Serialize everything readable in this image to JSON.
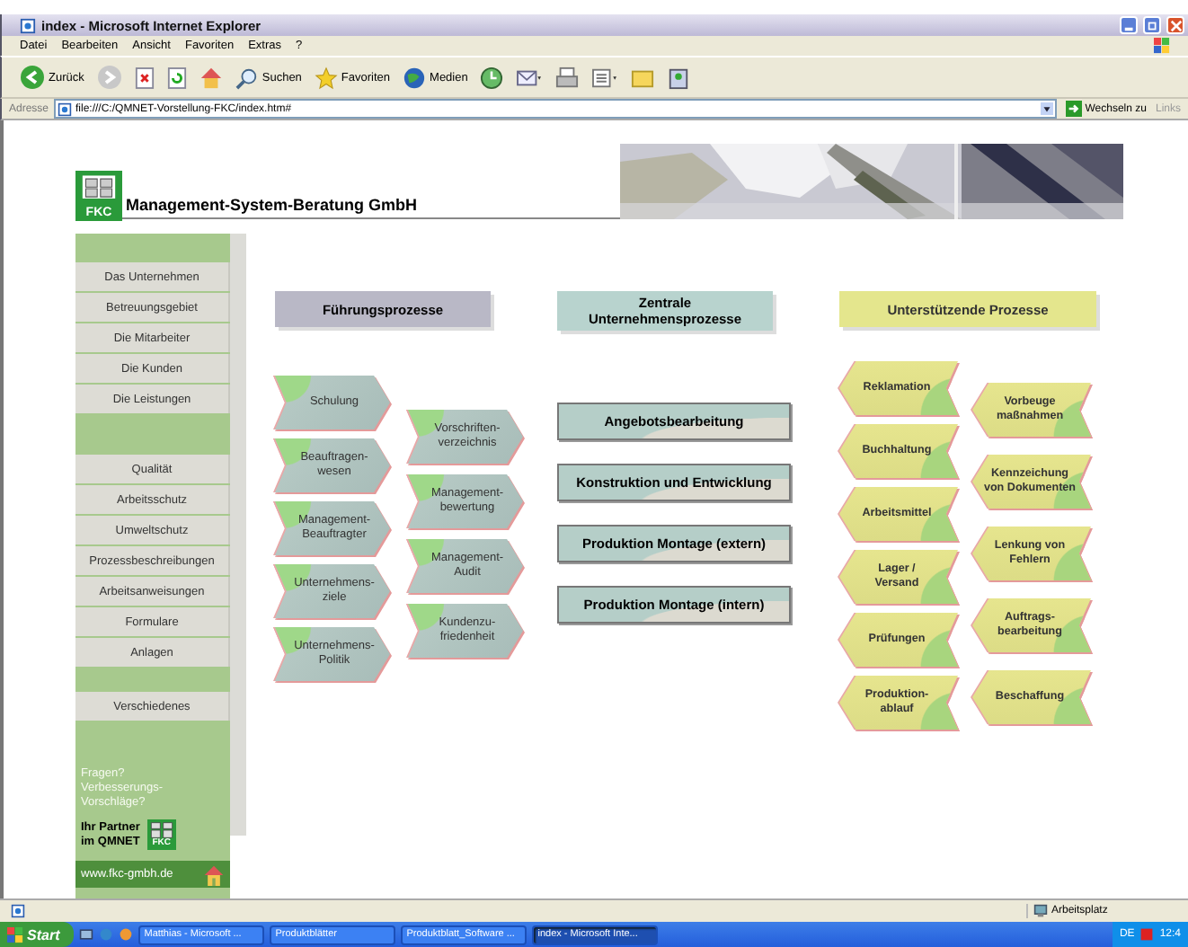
{
  "window": {
    "title": "index - Microsoft Internet Explorer"
  },
  "menu": [
    "Datei",
    "Bearbeiten",
    "Ansicht",
    "Favoriten",
    "Extras",
    "?"
  ],
  "toolbar": [
    {
      "kind": "back",
      "label": "Zurück"
    },
    {
      "kind": "forward"
    },
    {
      "kind": "stop"
    },
    {
      "kind": "refresh"
    },
    {
      "kind": "home"
    },
    {
      "kind": "search",
      "label": "Suchen"
    },
    {
      "kind": "favorites",
      "label": "Favoriten"
    },
    {
      "kind": "media",
      "label": "Medien"
    },
    {
      "kind": "history"
    },
    {
      "kind": "mail"
    },
    {
      "kind": "print"
    },
    {
      "kind": "edit"
    },
    {
      "kind": "folder"
    },
    {
      "kind": "messenger"
    }
  ],
  "address": {
    "label": "Adresse",
    "value": "file:///C:/QMNET-Vorstellung-FKC/index.htm#",
    "go": "Wechseln zu",
    "links": "Links"
  },
  "header": {
    "logo": "FKC",
    "company": "Management-System-Beratung GmbH"
  },
  "sidebar": {
    "items": [
      {
        "kind": "spacer"
      },
      {
        "kind": "link",
        "label": "Das Unternehmen"
      },
      {
        "kind": "link",
        "label": "Betreuungsgebiet"
      },
      {
        "kind": "link",
        "label": "Die Mitarbeiter"
      },
      {
        "kind": "link",
        "label": "Die Kunden"
      },
      {
        "kind": "link",
        "label": "Die Leistungen"
      },
      {
        "kind": "spacer"
      },
      {
        "kind": "link",
        "label": "Qualität"
      },
      {
        "kind": "link",
        "label": "Arbeitsschutz"
      },
      {
        "kind": "link",
        "label": "Umweltschutz"
      },
      {
        "kind": "link",
        "label": "Prozessbeschreibungen"
      },
      {
        "kind": "link",
        "label": "Arbeitsanweisungen"
      },
      {
        "kind": "link",
        "label": "Formulare"
      },
      {
        "kind": "link",
        "label": "Anlagen"
      },
      {
        "kind": "spacer"
      },
      {
        "kind": "link",
        "label": "Verschiedenes"
      }
    ],
    "question": "Fragen?\nVerbesserungs-\nVorschläge?",
    "partner": "Ihr Partner\nim QMNET",
    "partner_logo": "FKC",
    "website": "www.fkc-gmbh.de"
  },
  "fuehrung": {
    "title": "Führungsprozesse",
    "left": [
      "Schulung",
      "Beauftragen-\nwesen",
      "Management-\nBeauftragter",
      "Unternehmens-\nziele",
      "Unternehmens-\nPolitik"
    ],
    "right": [
      "Vorschriften-\nverzeichnis",
      "Management-\nbewertung",
      "Management-\nAudit",
      "Kundenzu-\nfriedenheit"
    ]
  },
  "zentral": {
    "title": "Zentrale\nUnternehmensprozesse",
    "items": [
      "Angebotsbearbeitung",
      "Konstruktion und Entwicklung",
      "Produktion Montage (extern)",
      "Produktion Montage (intern)"
    ]
  },
  "unterstuetzend": {
    "title": "Unterstützende Prozesse",
    "left": [
      "Reklamation",
      "Buchhaltung",
      "Arbeitsmittel",
      "Lager /\nVersand",
      "Prüfungen",
      "Produktion-\nablauf"
    ],
    "right": [
      "Vorbeuge\nmaßnahmen",
      "Kennzeichung\nvon Dokumenten",
      "Lenkung von\nFehlern",
      "Auftrags-\nbearbeitung",
      "Beschaffung"
    ]
  },
  "status_bar": {
    "zone": "Arbeitsplatz"
  },
  "taskbar": {
    "start": "Start",
    "items": [
      {
        "label": "Matthias - Microsoft ...",
        "selected": false
      },
      {
        "label": "Produktblätter",
        "selected": false
      },
      {
        "label": "Produktblatt_Software ...",
        "selected": false
      },
      {
        "label": "index - Microsoft Inte...",
        "selected": true
      }
    ],
    "language": "DE",
    "clock": "12:4"
  }
}
